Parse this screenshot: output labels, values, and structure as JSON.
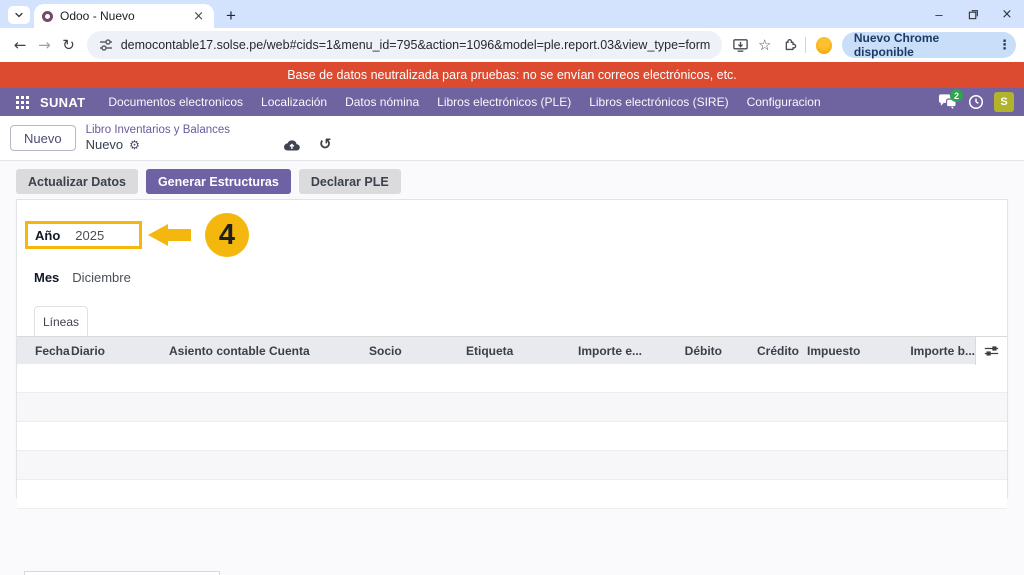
{
  "browser": {
    "tab_title": "Odoo - Nuevo",
    "url": "democontable17.solse.pe/web#cids=1&menu_id=795&action=1096&model=ple.report.03&view_type=form",
    "update_button_label": "Nuevo Chrome disponible"
  },
  "banner": {
    "text": "Base de datos neutralizada para pruebas: no se envían correos electrónicos, etc."
  },
  "navbar": {
    "brand": "SUNAT",
    "items": [
      "Documentos electronicos",
      "Localización",
      "Datos nómina",
      "Libros electrónicos (PLE)",
      "Libros electrónicos (SIRE)",
      "Configuracion"
    ],
    "messages_badge": "2",
    "user_initial": "S"
  },
  "breadcrumb": {
    "new_button_label": "Nuevo",
    "parent_link": "Libro Inventarios y Balances",
    "current": "Nuevo"
  },
  "actions": {
    "update_label": "Actualizar Datos",
    "generate_label": "Generar Estructuras",
    "declare_label": "Declarar PLE"
  },
  "form": {
    "year_label": "Año",
    "year_value": "2025",
    "month_label": "Mes",
    "month_value": "Diciembre",
    "annotation_step": "4",
    "lines_tab_label": "Líneas"
  },
  "table": {
    "headers": [
      "Fecha",
      "Diario",
      "Asiento contable",
      "Cuenta",
      "Socio",
      "Etiqueta",
      "Importe e...",
      "Débito",
      "Crédito",
      "Impuesto",
      "Importe b..."
    ],
    "empty_row_count": 5
  },
  "colors": {
    "accent_purple": "#6e61a4",
    "navbar_purple": "#6f63a0",
    "banner_red": "#dc4a30",
    "annotation_yellow": "#f4b70d",
    "badge_green": "#2ea44f",
    "avatar_olive": "#b1b32b",
    "chrome_titlebar_blue": "#d3e3fd"
  }
}
